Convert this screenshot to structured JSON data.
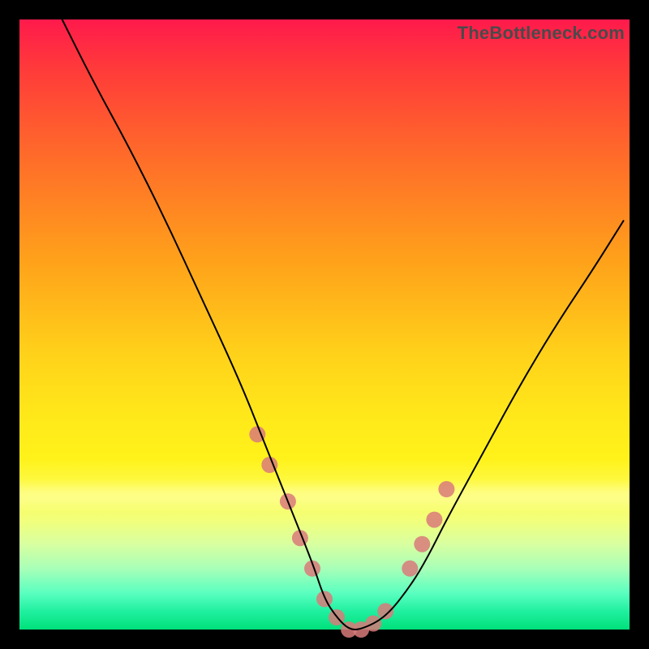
{
  "watermark": "TheBottleneck.com",
  "chart_data": {
    "type": "line",
    "title": "",
    "xlabel": "",
    "ylabel": "",
    "xlim": [
      0,
      100
    ],
    "ylim": [
      0,
      100
    ],
    "grid": false,
    "legend": false,
    "background_gradient": {
      "top": "#ff1a4c",
      "bottom": "#00e07a"
    },
    "series": [
      {
        "name": "bottleneck-curve",
        "stroke": "#000000",
        "stroke_width": 2,
        "x": [
          7,
          12,
          18,
          24,
          30,
          36,
          40,
          44,
          48,
          50,
          52,
          54,
          56,
          60,
          64,
          67,
          70,
          76,
          82,
          88,
          94,
          99
        ],
        "values": [
          100,
          90,
          79,
          67,
          54,
          41,
          31,
          21,
          11,
          5,
          2,
          0,
          0,
          2,
          7,
          12,
          18,
          29,
          40,
          50,
          59,
          67
        ]
      }
    ],
    "markers": {
      "name": "highlight-dots",
      "color": "#d97a7a",
      "radius_px": 10,
      "x": [
        39,
        41,
        44,
        46,
        48,
        50,
        52,
        54,
        56,
        58,
        60,
        64,
        66,
        68,
        70
      ],
      "values": [
        32,
        27,
        21,
        15,
        10,
        5,
        2,
        0,
        0,
        1,
        3,
        10,
        14,
        18,
        23
      ]
    }
  }
}
